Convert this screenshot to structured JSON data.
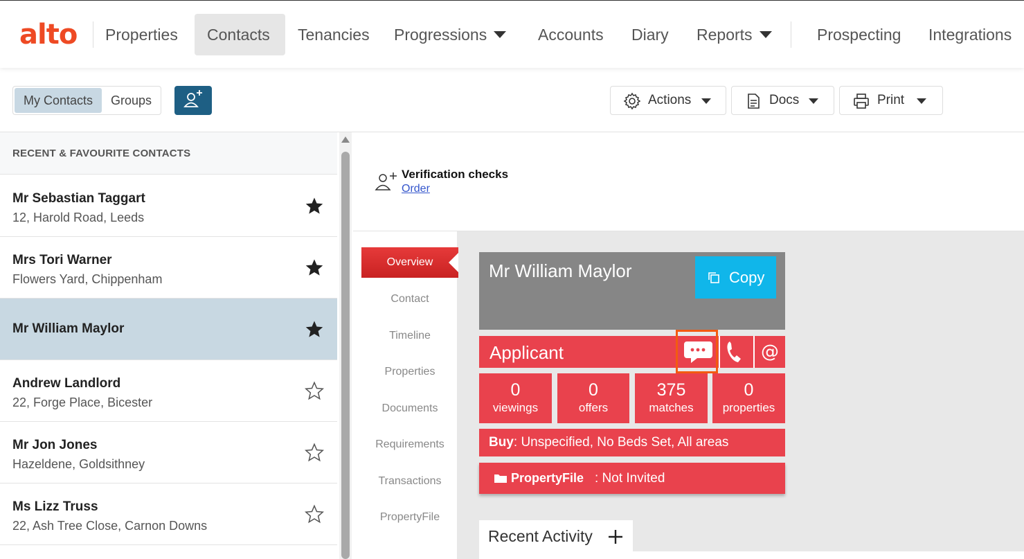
{
  "brand": {
    "logo": "alto",
    "accent": "#ee4a24"
  },
  "nav": {
    "items": [
      {
        "label": "Properties"
      },
      {
        "label": "Contacts",
        "active": true
      },
      {
        "label": "Tenancies"
      },
      {
        "label": "Progressions",
        "dropdown": true
      },
      {
        "label": "Accounts"
      },
      {
        "label": "Diary"
      },
      {
        "label": "Reports",
        "dropdown": true
      },
      {
        "label": "Prospecting"
      },
      {
        "label": "Integrations"
      }
    ]
  },
  "toolbar": {
    "my_contacts": "My Contacts",
    "groups": "Groups",
    "add_contact_icon": "add-person-icon",
    "actions": "Actions",
    "docs": "Docs",
    "print": "Print"
  },
  "contacts": {
    "heading": "RECENT & FAVOURITE CONTACTS",
    "items": [
      {
        "name": "Mr Sebastian Taggart",
        "address": "12, Harold Road, Leeds",
        "favourite": true
      },
      {
        "name": "Mrs Tori Warner",
        "address": "Flowers Yard, Chippenham",
        "favourite": true
      },
      {
        "name": "Mr William Maylor",
        "address": "",
        "favourite": true,
        "selected": true
      },
      {
        "name": "Andrew Landlord",
        "address": "22, Forge Place, Bicester",
        "favourite": false
      },
      {
        "name": "Mr Jon Jones",
        "address": "Hazeldene, Goldsithney",
        "favourite": false
      },
      {
        "name": "Ms Lizz Truss",
        "address": "22, Ash Tree Close, Carnon Downs",
        "favourite": false
      }
    ]
  },
  "verification": {
    "title": "Verification checks",
    "link": "Order"
  },
  "tabs": [
    "Overview",
    "Contact",
    "Timeline",
    "Properties",
    "Documents",
    "Requirements",
    "Transactions",
    "PropertyFile"
  ],
  "card": {
    "name": "Mr William Maylor",
    "copy": "Copy",
    "type": "Applicant",
    "stats": [
      {
        "value": "0",
        "label": "viewings"
      },
      {
        "value": "0",
        "label": "offers"
      },
      {
        "value": "375",
        "label": "matches"
      },
      {
        "value": "0",
        "label": "properties"
      }
    ],
    "buy_label": "Buy",
    "buy_text": ": Unspecified, No Beds Set, All areas",
    "propertyfile_brand": "PropertyFile",
    "propertyfile_status": ": Not Invited",
    "colors": {
      "red": "#e9424d",
      "copy": "#10b6ea",
      "header": "#868686"
    }
  },
  "recent_activity": {
    "title": "Recent Activity"
  }
}
